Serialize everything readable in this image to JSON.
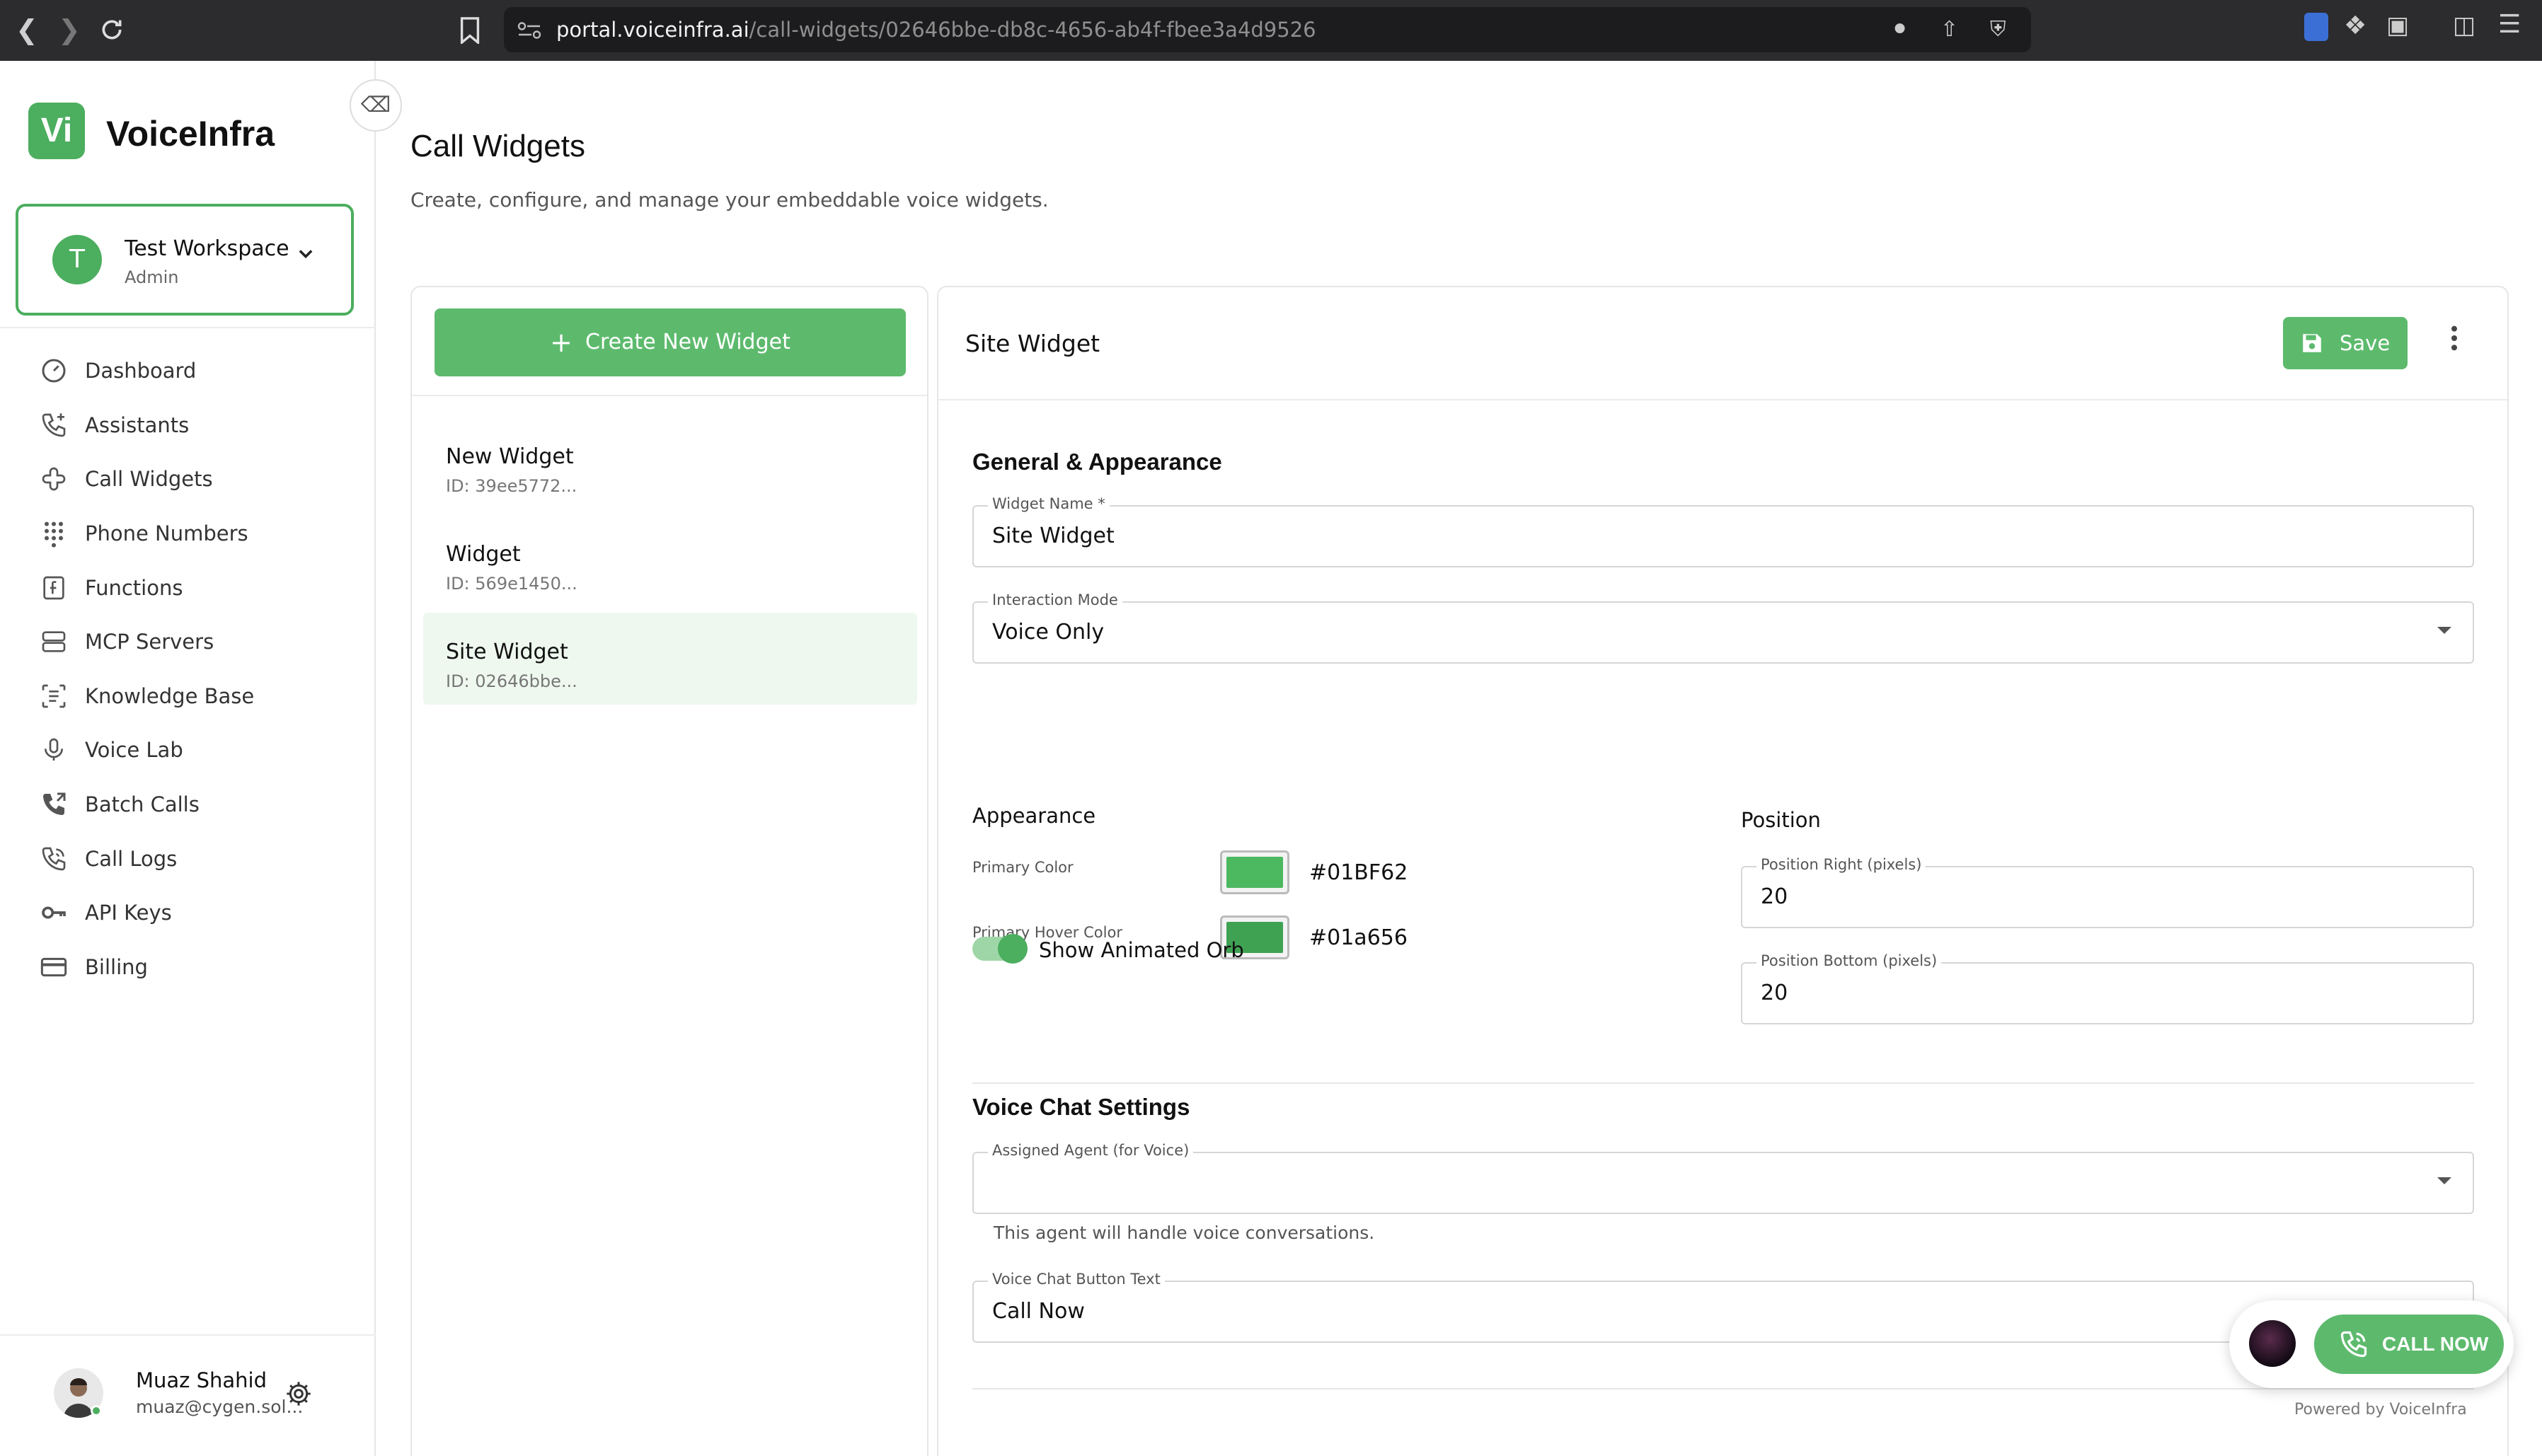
{
  "browser": {
    "url_host": "portal.voiceinfra.ai",
    "url_path": "/call-widgets/02646bbe-db8c-4656-ab4f-fbee3a4d9526"
  },
  "sidebar": {
    "brand": "VoiceInfra",
    "logo_text": "Vi",
    "workspace": {
      "initial": "T",
      "name": "Test Workspace",
      "role": "Admin"
    },
    "items": [
      {
        "label": "Dashboard",
        "icon": "dashboard-icon"
      },
      {
        "label": "Assistants",
        "icon": "phone-plus-icon"
      },
      {
        "label": "Call Widgets",
        "icon": "widget-icon"
      },
      {
        "label": "Phone Numbers",
        "icon": "dialpad-icon"
      },
      {
        "label": "Functions",
        "icon": "function-icon"
      },
      {
        "label": "MCP Servers",
        "icon": "server-icon"
      },
      {
        "label": "Knowledge Base",
        "icon": "document-icon"
      },
      {
        "label": "Voice Lab",
        "icon": "microphone-icon"
      },
      {
        "label": "Batch Calls",
        "icon": "batch-call-icon"
      },
      {
        "label": "Call Logs",
        "icon": "call-log-icon"
      },
      {
        "label": "API Keys",
        "icon": "key-icon"
      },
      {
        "label": "Billing",
        "icon": "card-icon"
      }
    ],
    "user": {
      "name": "Muaz Shahid",
      "email": "muaz@cygen.sol..."
    }
  },
  "page": {
    "title": "Call Widgets",
    "subtitle": "Create, configure, and manage your embeddable voice widgets."
  },
  "widget_list": {
    "create_label": "Create New Widget",
    "items": [
      {
        "name": "New Widget",
        "id": "ID: 39ee5772..."
      },
      {
        "name": "Widget",
        "id": "ID: 569e1450..."
      },
      {
        "name": "Site Widget",
        "id": "ID: 02646bbe..."
      }
    ]
  },
  "editor": {
    "title": "Site Widget",
    "save_label": "Save",
    "general": {
      "heading": "General & Appearance",
      "name_label": "Widget Name *",
      "name_value": "Site Widget",
      "mode_label": "Interaction Mode",
      "mode_value": "Voice Only"
    },
    "appearance": {
      "heading": "Appearance",
      "primary_label": "Primary Color",
      "primary_value": "#01BF62",
      "hover_label": "Primary Hover Color",
      "hover_value": "#01a656",
      "orb_label": "Show Animated Orb",
      "orb_enabled": true
    },
    "position": {
      "heading": "Position",
      "right_label": "Position Right (pixels)",
      "right_value": "20",
      "bottom_label": "Position Bottom (pixels)",
      "bottom_value": "20"
    },
    "voice": {
      "heading": "Voice Chat Settings",
      "agent_label": "Assigned Agent (for Voice)",
      "agent_value": "",
      "agent_hint": "This agent will handle voice conversations.",
      "button_text_label": "Voice Chat Button Text",
      "button_text_value": "Call Now"
    }
  },
  "preview": {
    "call_label": "CALL NOW",
    "powered_by": "Powered by VoiceInfra"
  },
  "colors": {
    "accent": "#5dba6d",
    "swatch_primary": "#4cb860",
    "swatch_hover": "#3fa253"
  }
}
